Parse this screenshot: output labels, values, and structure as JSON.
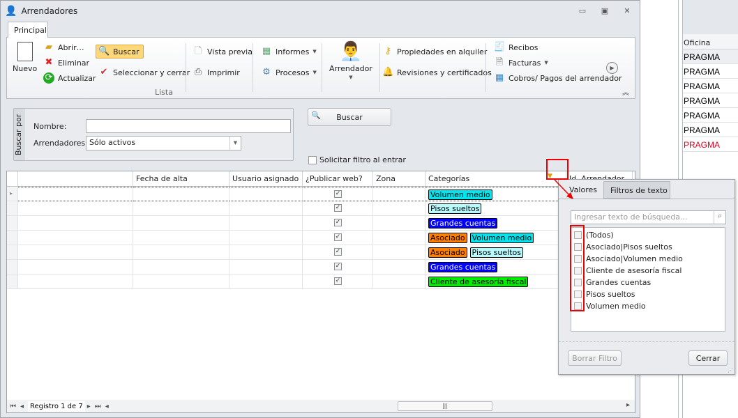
{
  "window": {
    "title": "Arrendadores"
  },
  "ribbon": {
    "tab": "Principal",
    "group_label": "Lista",
    "nuevo": "Nuevo",
    "abrir": "Abrir…",
    "eliminar": "Eliminar",
    "actualizar": "Actualizar",
    "buscar": "Buscar",
    "seleccionar": "Seleccionar y cerrar",
    "vista_previa": "Vista previa",
    "imprimir": "Imprimir",
    "informes": "Informes",
    "procesos": "Procesos",
    "arrendador": "Arrendador",
    "propiedades": "Propiedades en alquiler",
    "revisiones": "Revisiones y certificados",
    "recibos": "Recibos",
    "facturas": "Facturas",
    "cobros": "Cobros/ Pagos del arrendador"
  },
  "search": {
    "group_label": "Buscar por",
    "nombre_label": "Nombre:",
    "nombre_value": "",
    "arrendadores_label": "Arrendadores:",
    "arrendadores_value": "Sólo activos",
    "buscar_button": "Buscar",
    "solicitar_filtro": "Solicitar filtro al entrar"
  },
  "grid": {
    "columns": [
      "",
      "Fecha de alta",
      "Usuario asignado",
      "¿Publicar web?",
      "Zona",
      "Categorías",
      "Id. Arrendador"
    ],
    "rows": [
      {
        "publicar": true,
        "tags": [
          {
            "text": "Volumen medio",
            "bg": "#00e5ee",
            "fg": "#000"
          }
        ]
      },
      {
        "publicar": true,
        "tags": [
          {
            "text": "Pisos sueltos",
            "bg": "#b8fbff",
            "fg": "#000"
          }
        ]
      },
      {
        "publicar": true,
        "tags": [
          {
            "text": "Grandes cuentas",
            "bg": "#0000ff",
            "fg": "#fff"
          }
        ]
      },
      {
        "publicar": true,
        "tags": [
          {
            "text": "Asociado",
            "bg": "#ff7f00",
            "fg": "#000"
          },
          {
            "text": "Volumen medio",
            "bg": "#00e5ee",
            "fg": "#000"
          }
        ]
      },
      {
        "publicar": true,
        "tags": [
          {
            "text": "Asociado",
            "bg": "#ff7f00",
            "fg": "#000"
          },
          {
            "text": "Pisos sueltos",
            "bg": "#b8fbff",
            "fg": "#000"
          }
        ]
      },
      {
        "publicar": true,
        "tags": [
          {
            "text": "Grandes cuentas",
            "bg": "#0000ff",
            "fg": "#fff"
          }
        ]
      },
      {
        "publicar": true,
        "tags": [
          {
            "text": "Cliente de asesoría fiscal",
            "bg": "#00ee00",
            "fg": "#000"
          }
        ]
      }
    ],
    "navigator": "Registro 1 de 7"
  },
  "filter_popup": {
    "tabs": [
      "Valores",
      "Filtros de texto"
    ],
    "search_placeholder": "Ingresar texto de búsqueda...",
    "items": [
      "(Todos)",
      "Asociado|Pisos sueltos",
      "Asociado|Volumen medio",
      "Cliente de asesoría fiscal",
      "Grandes cuentas",
      "Pisos sueltos",
      "Volumen medio"
    ],
    "clear_button": "Borrar Filtro",
    "close_button": "Cerrar"
  },
  "background_grid": {
    "column": "Oficina",
    "rows": [
      {
        "text": "PRAGMA",
        "color": "#000"
      },
      {
        "text": "PRAGMA",
        "color": "#000"
      },
      {
        "text": "PRAGMA",
        "color": "#000"
      },
      {
        "text": "PRAGMA",
        "color": "#000"
      },
      {
        "text": "PRAGMA",
        "color": "#000"
      },
      {
        "text": "PRAGMA",
        "color": "#000"
      },
      {
        "text": "PRAGMA",
        "color": "#e8001c"
      }
    ]
  }
}
